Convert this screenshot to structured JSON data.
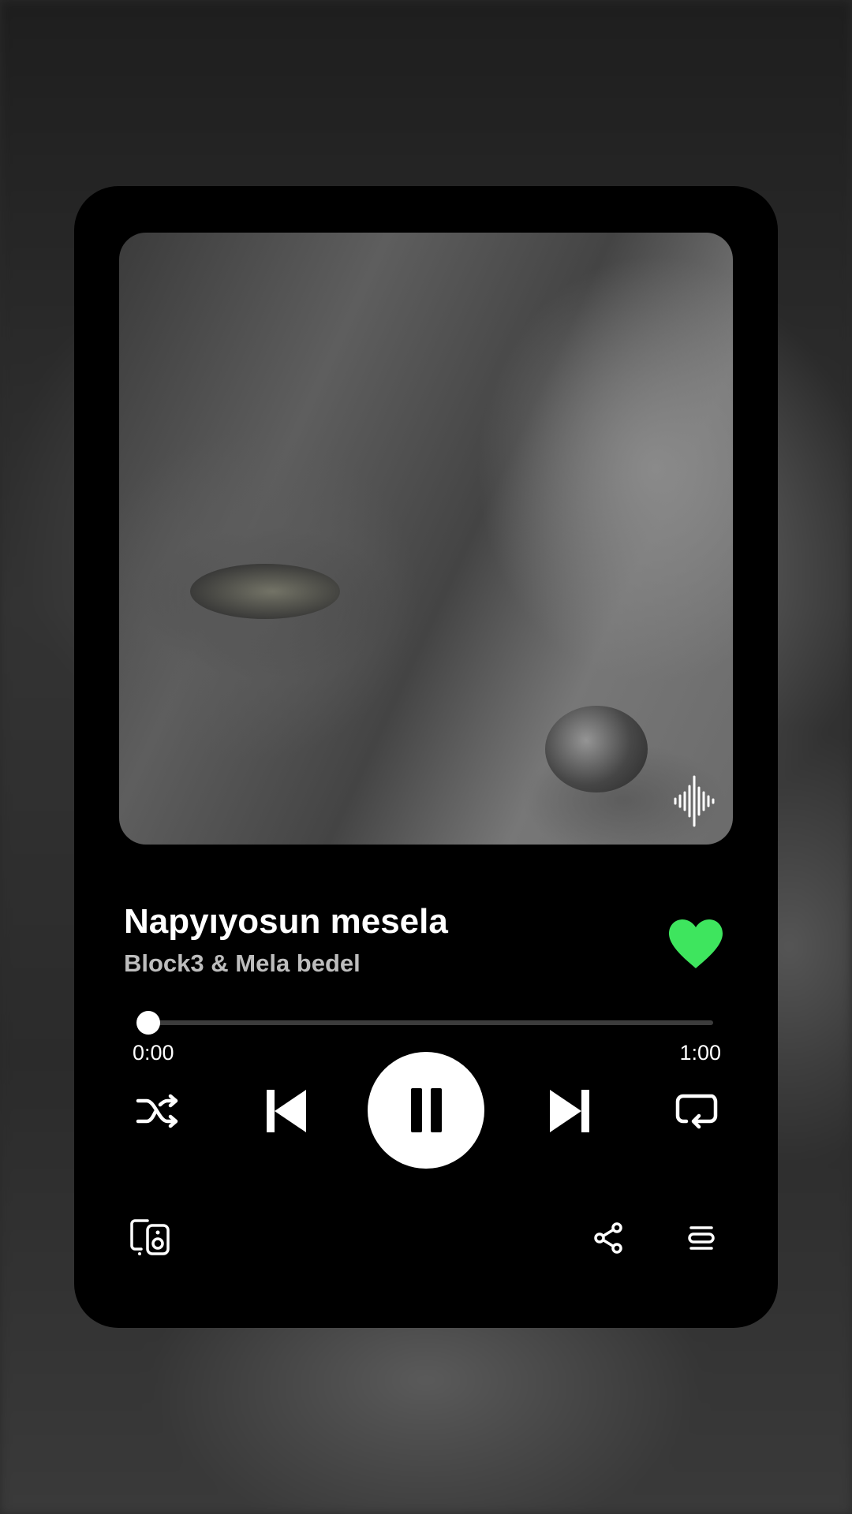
{
  "track": {
    "title": "Napyıyosun mesela",
    "artist": "Block3 & Mela bedel",
    "liked": true
  },
  "progress": {
    "current": "0:00",
    "total": "1:00",
    "fraction": 0.0
  },
  "controls": {
    "shuffle": "shuffle-icon",
    "previous": "skip-previous-icon",
    "play_state": "pause-icon",
    "next": "skip-next-icon",
    "repeat": "repeat-icon"
  },
  "footer": {
    "devices": "connect-device-icon",
    "share": "share-icon",
    "queue": "queue-icon"
  },
  "colors": {
    "card": "#000000",
    "heart": "#3ee55e",
    "text_primary": "#ffffff",
    "text_secondary": "#bdbdbd",
    "track": "#3c3c3c"
  }
}
